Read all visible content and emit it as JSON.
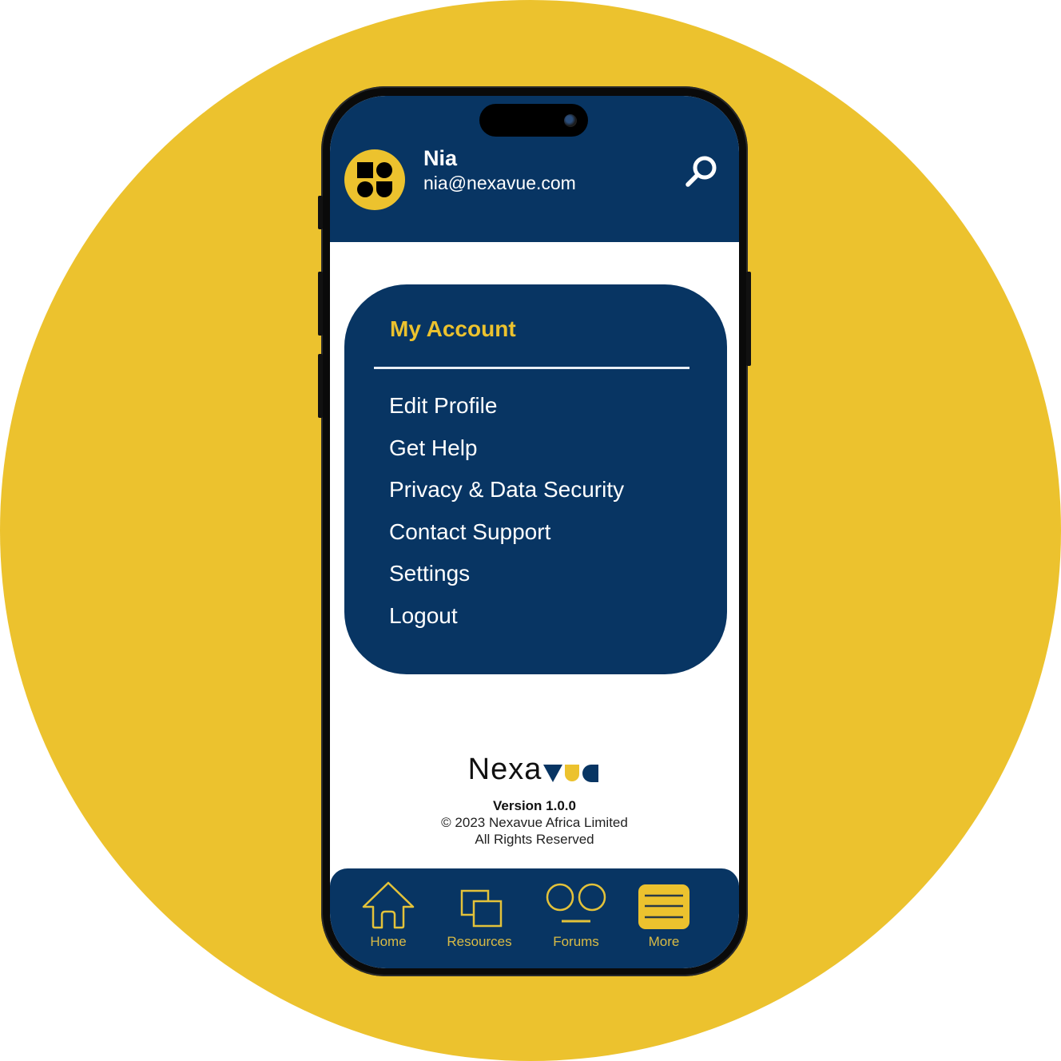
{
  "colors": {
    "background_yellow": "#ecc22e",
    "navy": "#083563",
    "accent_yellow": "#ecc22e",
    "nav_label": "#d9bb45",
    "white": "#ffffff"
  },
  "header": {
    "user_name": "Nia",
    "user_email": "nia@nexavue.com",
    "avatar_icon": "nexavue-shapes-logo",
    "search_icon": "search-icon"
  },
  "account_menu": {
    "title": "My Account",
    "items": [
      {
        "label": "Edit Profile"
      },
      {
        "label": "Get Help"
      },
      {
        "label": "Privacy & Data Security"
      },
      {
        "label": "Contact Support"
      },
      {
        "label": "Settings"
      },
      {
        "label": "Logout"
      }
    ]
  },
  "footer": {
    "brand_text": "Nexa",
    "brand_mark": "vuc-shapes",
    "version": "Version 1.0.0",
    "copyright": "© 2023 Nexavue Africa Limited",
    "rights": "All Rights Reserved"
  },
  "bottom_nav": {
    "items": [
      {
        "label": "Home",
        "icon": "home-icon",
        "active": false
      },
      {
        "label": "Resources",
        "icon": "resources-icon",
        "active": false
      },
      {
        "label": "Forums",
        "icon": "forums-icon",
        "active": false
      },
      {
        "label": "More",
        "icon": "menu-icon",
        "active": true
      }
    ]
  }
}
